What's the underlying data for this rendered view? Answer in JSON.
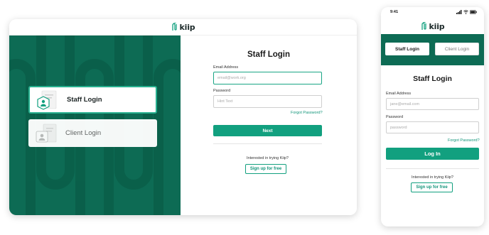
{
  "brand": {
    "name": "kiip",
    "accent": "#12a07f",
    "dark_green": "#0d6b54"
  },
  "desktop": {
    "roles": [
      {
        "label": "Staff Login",
        "icon": "staff-id-icon",
        "active": true
      },
      {
        "label": "Client Login",
        "icon": "client-id-icon",
        "active": false
      }
    ],
    "form": {
      "title": "Staff Login",
      "email_label": "Email Address",
      "email_placeholder": "email@work.org",
      "password_label": "Password",
      "password_placeholder": "Hint Text",
      "forgot": "Forgot Password?",
      "submit": "Next",
      "interest": "Interested in trying Kiip?",
      "signup": "Sign up for free"
    }
  },
  "mobile": {
    "time": "9:41",
    "tabs": [
      {
        "label": "Staff Login",
        "active": true
      },
      {
        "label": "Client Login",
        "active": false
      }
    ],
    "form": {
      "title": "Staff Login",
      "email_label": "Email Address",
      "email_placeholder": "jane@email.com",
      "password_label": "Password",
      "password_placeholder": "password",
      "forgot": "Forgot Password?",
      "submit": "Log In",
      "interest": "Interested in trying Kiip?",
      "signup": "Sign up for free"
    }
  }
}
